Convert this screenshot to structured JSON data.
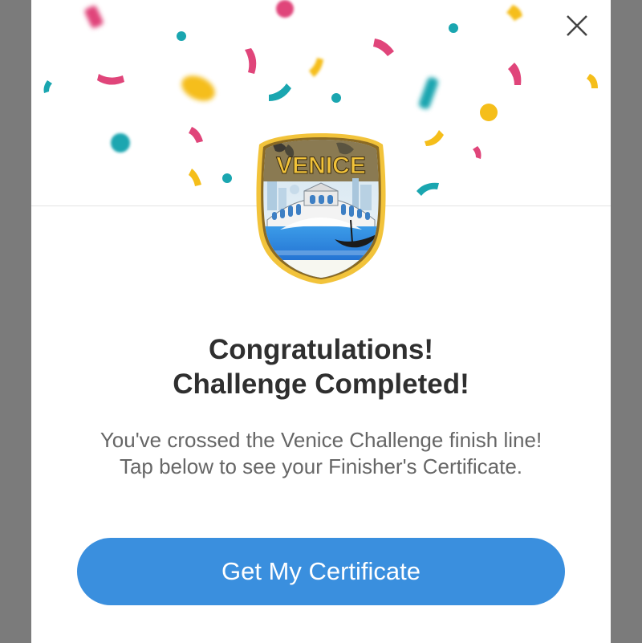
{
  "modal": {
    "close_icon": "close-icon",
    "badge": {
      "label": "VENICE",
      "icon": "venice-badge-icon"
    },
    "title_line1": "Congratulations!",
    "title_line2": "Challenge Completed!",
    "message": "You've crossed the Venice Challenge finish line! Tap below to see your Finisher's Certificate.",
    "cta_label": "Get My Certificate"
  },
  "colors": {
    "backdrop": "#7b7b7b",
    "modal_bg": "#ffffff",
    "button": "#3a8fde",
    "title_text": "#2f2f2f",
    "body_text": "#666666",
    "confetti_pink": "#e0457a",
    "confetti_teal": "#1aa6b0",
    "confetti_yellow": "#f5be1a"
  }
}
